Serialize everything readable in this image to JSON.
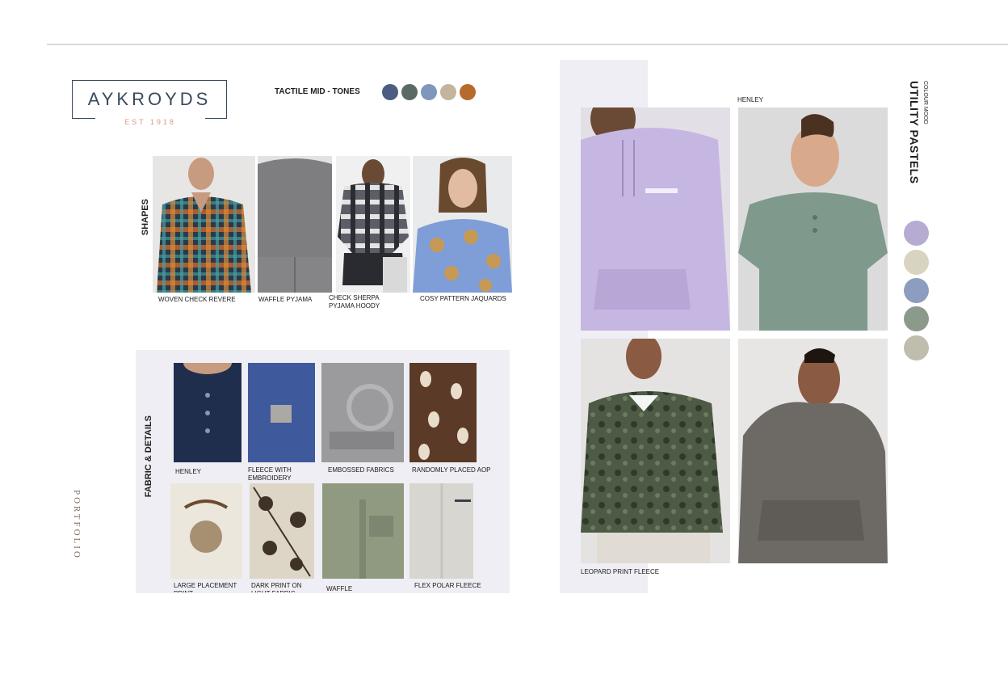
{
  "brand": {
    "name": "AYKROYDS",
    "tagline": "EST 1918"
  },
  "palette_title": "TACTILE MID - TONES",
  "palette_colors": [
    "#4b5d80",
    "#5a6b66",
    "#7f97bd",
    "#c5b49c",
    "#b66a2c"
  ],
  "shapes": {
    "title": "SHAPES",
    "items": [
      {
        "label": "WOVEN CHECK REVERE"
      },
      {
        "label": "WAFFLE PYJAMA"
      },
      {
        "label": "CHECK SHERPA PYJAMA HOODY"
      },
      {
        "label": "COSY PATTERN JAQUARDS"
      }
    ]
  },
  "fabric": {
    "title": "FABRIC & DETAILS",
    "items": [
      {
        "label": "HENLEY"
      },
      {
        "label": "FLEECE WITH EMBROIDERY"
      },
      {
        "label": "EMBOSSED FABRICS"
      },
      {
        "label": "RANDOMLY PLACED AOP"
      },
      {
        "label": "LARGE PLACEMENT PRINT"
      },
      {
        "label": "DARK PRINT ON LIGHT FABRIC"
      },
      {
        "label": "WAFFLE"
      },
      {
        "label": "FLEX POLAR FLEECE"
      }
    ]
  },
  "portfolio": "PORTFOLIO",
  "utility": {
    "kicker": "COLOUR MOOD",
    "title": "UTILITY PASTELS",
    "henley_label": "HENLEY",
    "leopard_label": "LEOPARD PRINT FLEECE",
    "swatches": [
      "#b6abd1",
      "#d9d4c1",
      "#8c9dbf",
      "#8c9a8b",
      "#c0bcae"
    ]
  }
}
